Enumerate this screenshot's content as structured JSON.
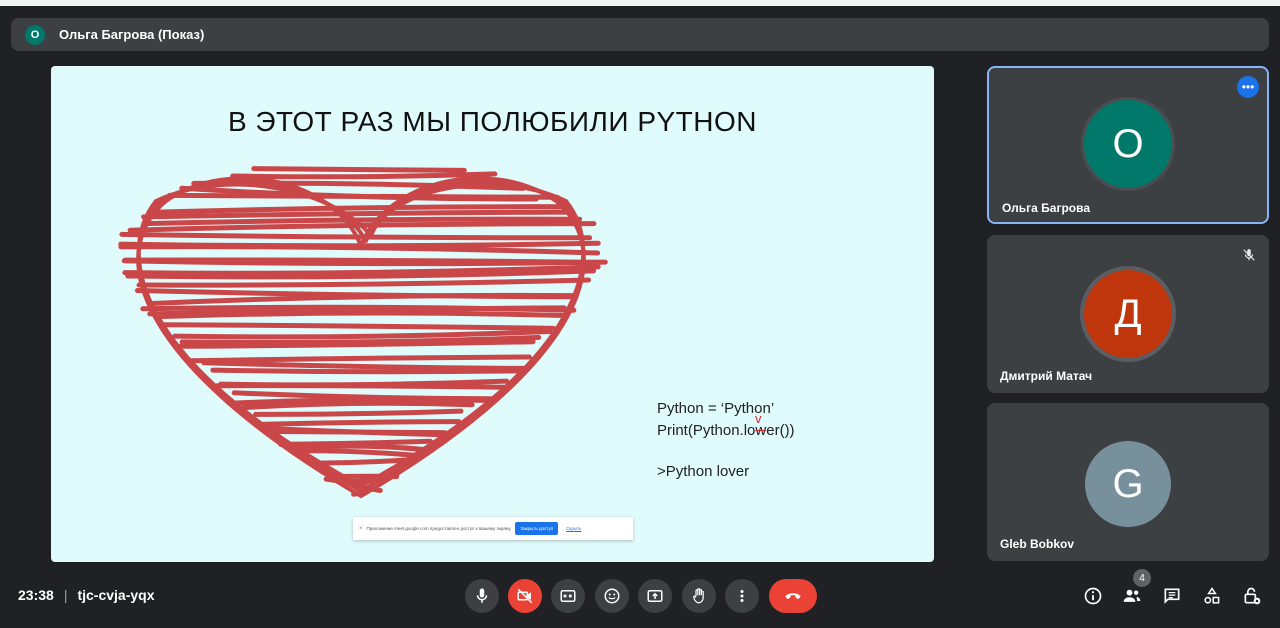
{
  "presenter_bar": {
    "avatar_letter": "О",
    "label": "Ольга Багрова (Показ)"
  },
  "slide": {
    "title": "В ЭТОТ РАЗ МЫ ПОЛЮБИЛИ PYTHON",
    "code_line1": "Python = ‘Python’",
    "code_line2_a": "Print(Python.lo",
    "code_line2_b": "w",
    "code_line2_c": "er())",
    "code_mark": "v",
    "output": ">Python lover",
    "share_notice": {
      "text": "Приложение meet.google.com предоставлен доступ к вашему экрану.",
      "stop_label": "Закрыть доступ",
      "hide_label": "Скрыть"
    }
  },
  "participants": [
    {
      "initial": "О",
      "name": "Ольга Багрова",
      "color": "#00796b",
      "active": true
    },
    {
      "initial": "Д",
      "name": "Дмитрий Матач",
      "color": "#bf360c",
      "muted": true
    },
    {
      "initial": "G",
      "name": "Gleb Bobkov",
      "color": "#78909c"
    }
  ],
  "bottom": {
    "time": "23:38",
    "separator": "|",
    "meeting_code": "tjc-cvja-yqx",
    "people_count": "4"
  },
  "icons": {
    "mic": "mic-icon",
    "camera_off": "camera-off-icon",
    "captions": "captions-icon",
    "emoji": "emoji-icon",
    "present": "present-icon",
    "hand": "raise-hand-icon",
    "more": "more-vert-icon",
    "hangup": "hangup-icon",
    "info": "info-icon",
    "people": "people-icon",
    "chat": "chat-icon",
    "activities": "activities-icon",
    "host": "host-controls-icon"
  }
}
